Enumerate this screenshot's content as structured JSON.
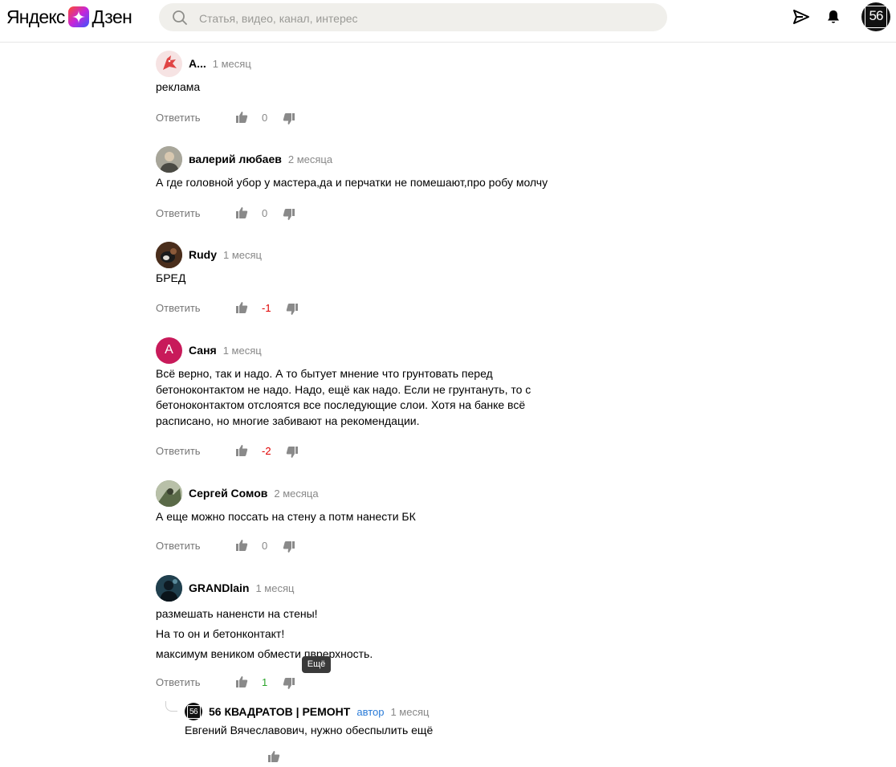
{
  "header": {
    "logo_yandex": "Яндекс",
    "logo_dzen": "Дзен",
    "search_placeholder": "Статья, видео, канал, интерес",
    "avatar_text": "56"
  },
  "reply_label": "Ответить",
  "comments": [
    {
      "author": "А...",
      "time": "1 месяц",
      "lines": [
        "реклама"
      ],
      "rating": "0",
      "avatar": {
        "kind": "image",
        "color": "#e85a5a"
      }
    },
    {
      "author": "валерий любаев",
      "time": "2 месяца",
      "lines": [
        "А где головной убор у мастера,да и перчатки не помешают,про робу молчу"
      ],
      "rating": "0",
      "avatar": {
        "kind": "image",
        "color": "#8a8a80"
      }
    },
    {
      "author": "Rudy",
      "time": "1 месяц",
      "lines": [
        "БРЕД"
      ],
      "rating": "-1",
      "avatar": {
        "kind": "image",
        "color": "#5a3a25"
      }
    },
    {
      "author": "Саня",
      "time": "1 месяц",
      "lines": [
        "Всё верно, так и надо. А то бытует мнение что грунтовать перед",
        "бетоноконтактом не надо. Надо, ещё как надо. Если не грунтануть, то с",
        "бетоноконтактом отслоятся все последующие слои. Хотя на банке всё",
        "расписано, но многие забивают на рекомендации."
      ],
      "rating": "-2",
      "avatar": {
        "kind": "letter",
        "letter": "А",
        "color": "#c81a5a"
      }
    },
    {
      "author": "Сергей Сомов",
      "time": "2 месяца",
      "lines": [
        "А еще можно поссать на стену а потм нанести БК"
      ],
      "rating": "0",
      "avatar": {
        "kind": "image",
        "color": "#7c8a6a"
      }
    },
    {
      "author": "GRANDlain",
      "time": "1 месяц",
      "lines": [
        "размешать наненсти на стены!",
        "На то он и бетонконтакт!",
        "максимум веником обмести пврерхность."
      ],
      "rating": "1",
      "avatar": {
        "kind": "image",
        "color": "#1e3a4a"
      }
    }
  ],
  "tooltip": "Ещё",
  "reply": {
    "author": "56 КВАДРАТОВ | РЕМОНТ",
    "badge": "автор",
    "time": "1 месяц",
    "text": "Евгений Вячеславович, нужно обеспылить ещё",
    "avatar_text": "56"
  },
  "colors": {
    "negative": "#e00000",
    "positive": "#2aa52a",
    "neutral": "#888888",
    "link": "#2a7bd8"
  }
}
